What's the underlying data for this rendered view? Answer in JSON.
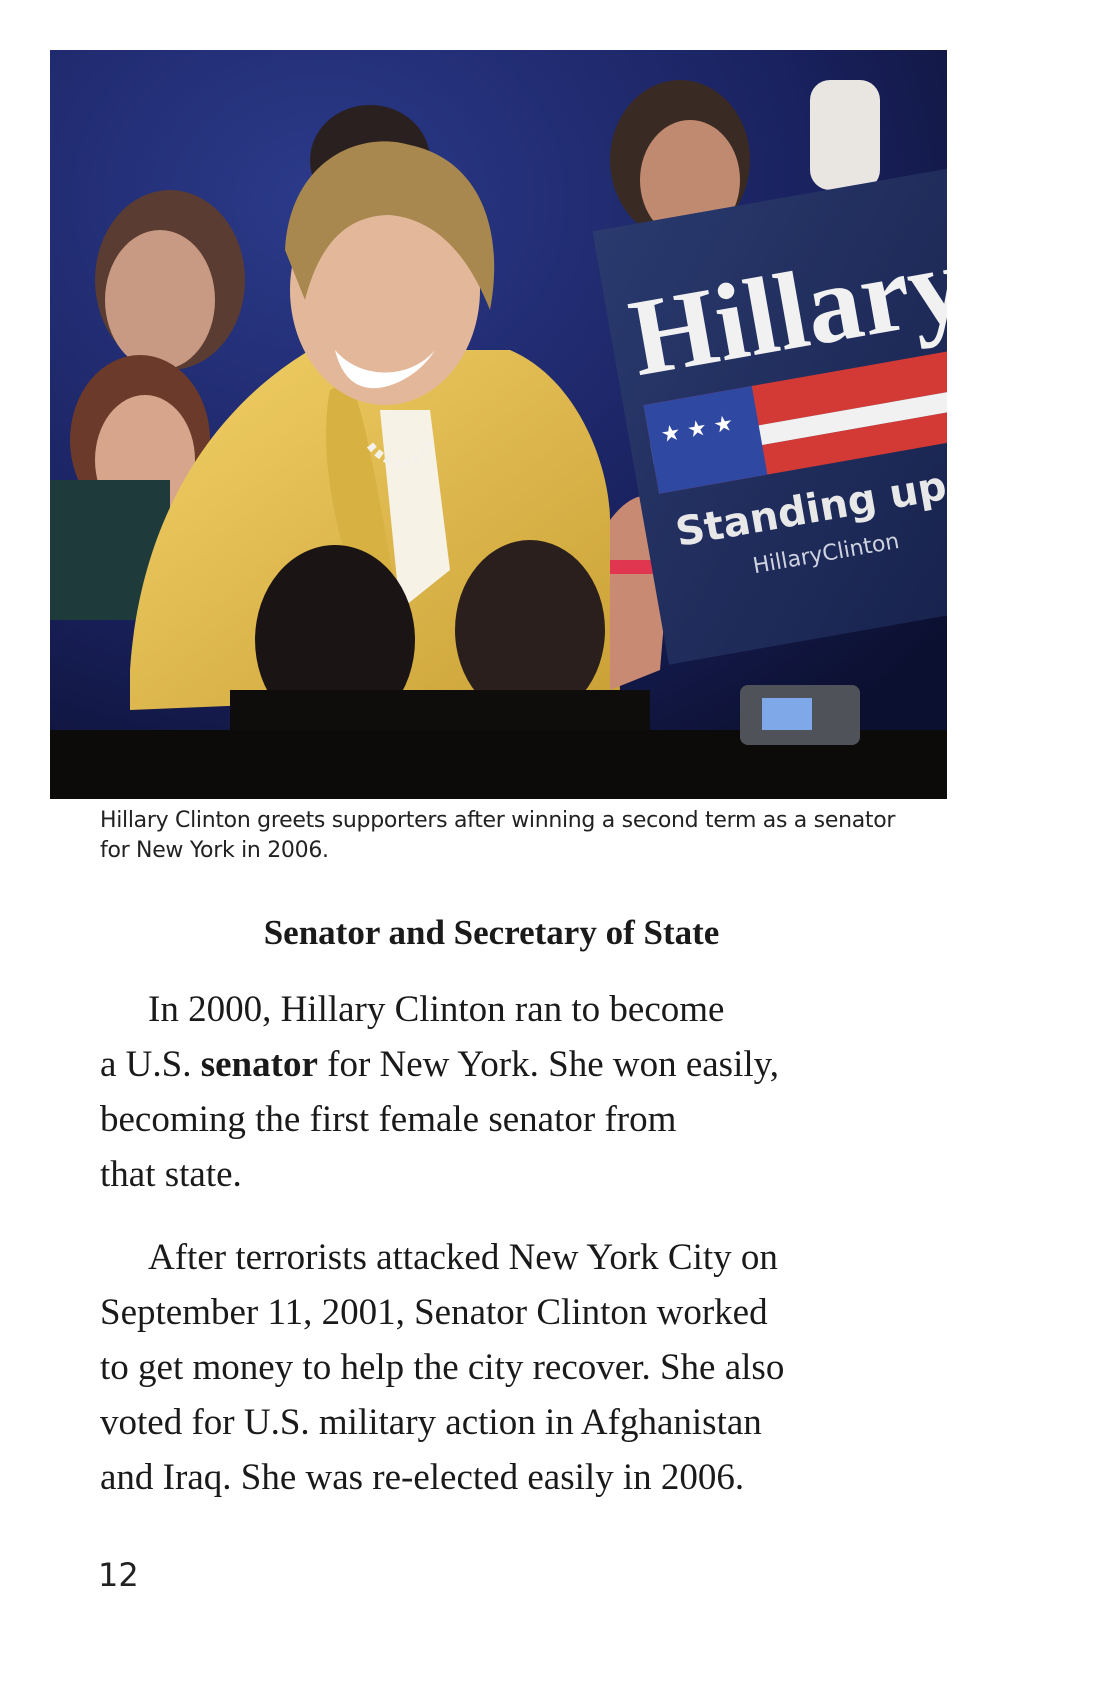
{
  "photo": {
    "sign_text": "Hillary",
    "sign_slogan": "Standing up for",
    "sign_url": "HillaryClinton"
  },
  "caption": {
    "line1": "Hillary Clinton greets supporters after winning a second term as a senator",
    "line2": "for New York in 2006."
  },
  "heading": "Senator and Secretary of State",
  "paragraph1": {
    "line1": "In 2000, Hillary Clinton ran to become",
    "line2_before": "a U.S. ",
    "line2_bold": "senator",
    "line2_after": " for New York. She won easily,",
    "line3": "becoming the first female senator from",
    "line4": "that state."
  },
  "paragraph2": {
    "lines": [
      "After terrorists attacked New York City on",
      "September 11, 2001, Senator Clinton worked",
      "to get money to help the city recover. She also",
      "voted for U.S. military action in Afghanistan",
      "and Iraq. She was re-elected easily in 2006."
    ]
  },
  "page_number": "12",
  "colors": {
    "background": "#ffffff",
    "text": "#1a1a1a",
    "jacket": "#e8c24a",
    "sign": "#1f2d5c"
  }
}
